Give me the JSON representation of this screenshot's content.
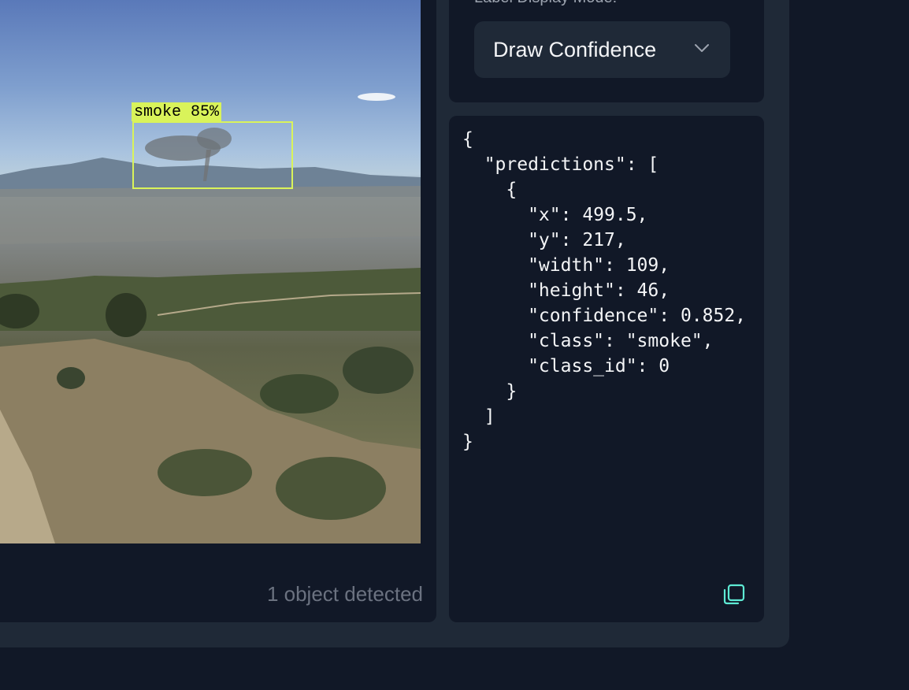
{
  "settings": {
    "label": "Label Display Mode:",
    "mode_value": "Draw Confidence"
  },
  "detection": {
    "label": "smoke 85%",
    "summary": "1 object detected"
  },
  "json_output": "{\n  \"predictions\": [\n    {\n      \"x\": 499.5,\n      \"y\": 217,\n      \"width\": 109,\n      \"height\": 46,\n      \"confidence\": 0.852,\n      \"class\": \"smoke\",\n      \"class_id\": 0\n    }\n  ]\n}",
  "icons": {
    "dropdown": "chevron-down-icon",
    "copy": "copy-icon"
  },
  "colors": {
    "accent": "#5eead4",
    "box": "#d9f35a"
  }
}
